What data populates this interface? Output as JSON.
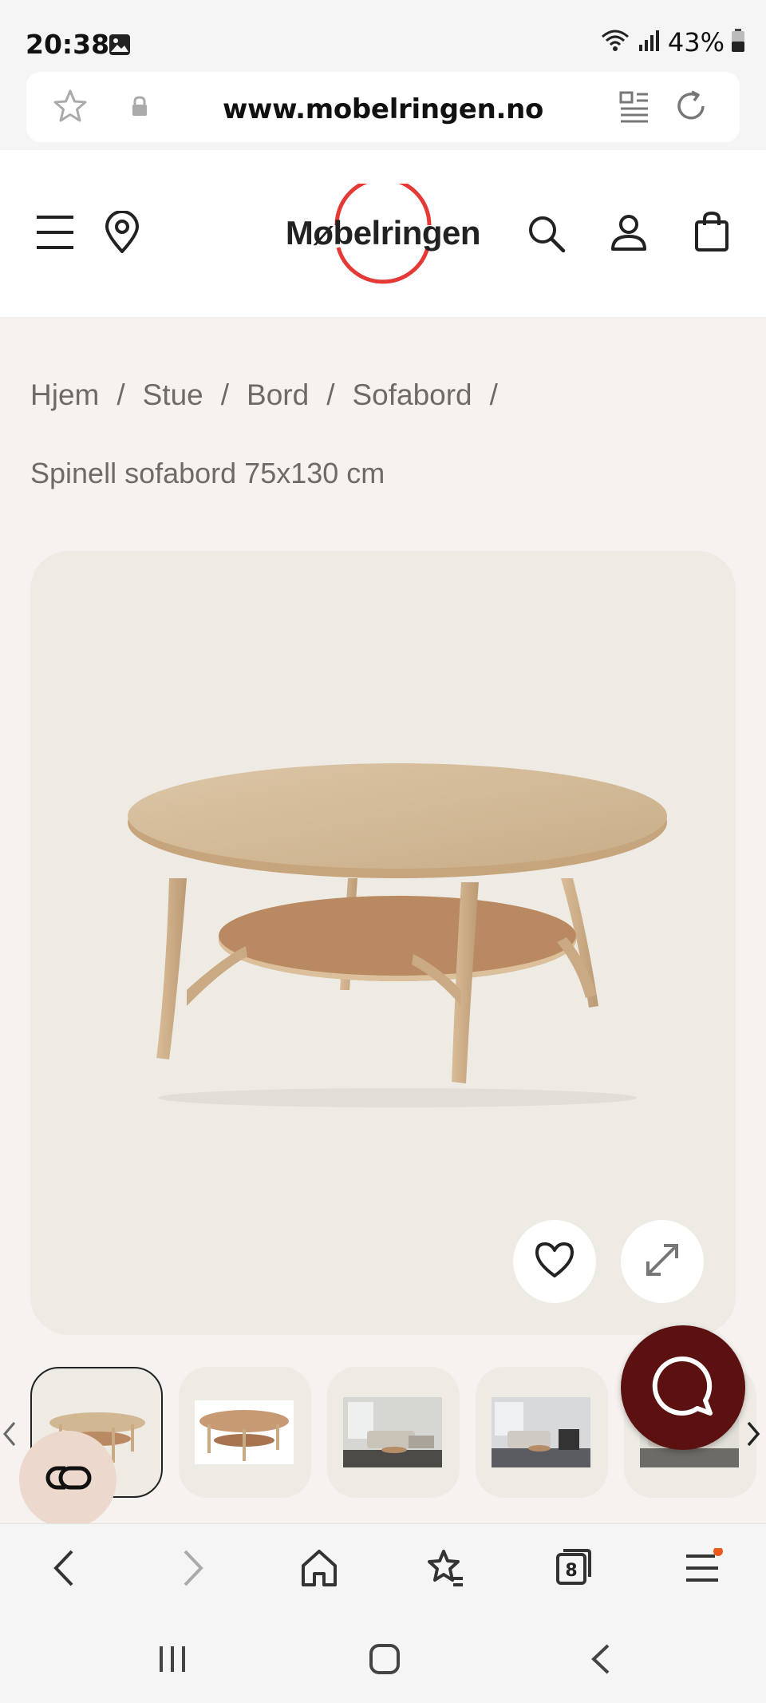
{
  "status_bar": {
    "time": "20:38",
    "battery_percent": "43%",
    "icons": [
      "gallery-icon",
      "wifi-icon",
      "signal-icon",
      "battery-icon"
    ]
  },
  "browser": {
    "url": "www.mobelringen.no",
    "open_tabs": "8",
    "toolbar_icons": [
      "back-icon",
      "forward-icon",
      "home-icon",
      "bookmarks-icon",
      "tabs-icon",
      "menu-icon"
    ]
  },
  "header": {
    "logo_text": "Møbelringen",
    "brand_color": "#e53935",
    "icons": [
      "menu-icon",
      "location-icon",
      "search-icon",
      "account-icon",
      "cart-icon"
    ]
  },
  "breadcrumb": {
    "items": [
      "Hjem",
      "Stue",
      "Bord",
      "Sofabord"
    ],
    "separator": "/"
  },
  "product": {
    "title": "Spinell sofabord 75x130 cm",
    "thumbnail_count": 5,
    "active_thumbnail": 1
  },
  "colors": {
    "chat_button": "#5c1111",
    "cookie_button": "#ecd8cc",
    "card_background": "#eeebe5",
    "notification_dot": "#ea5b1b"
  }
}
